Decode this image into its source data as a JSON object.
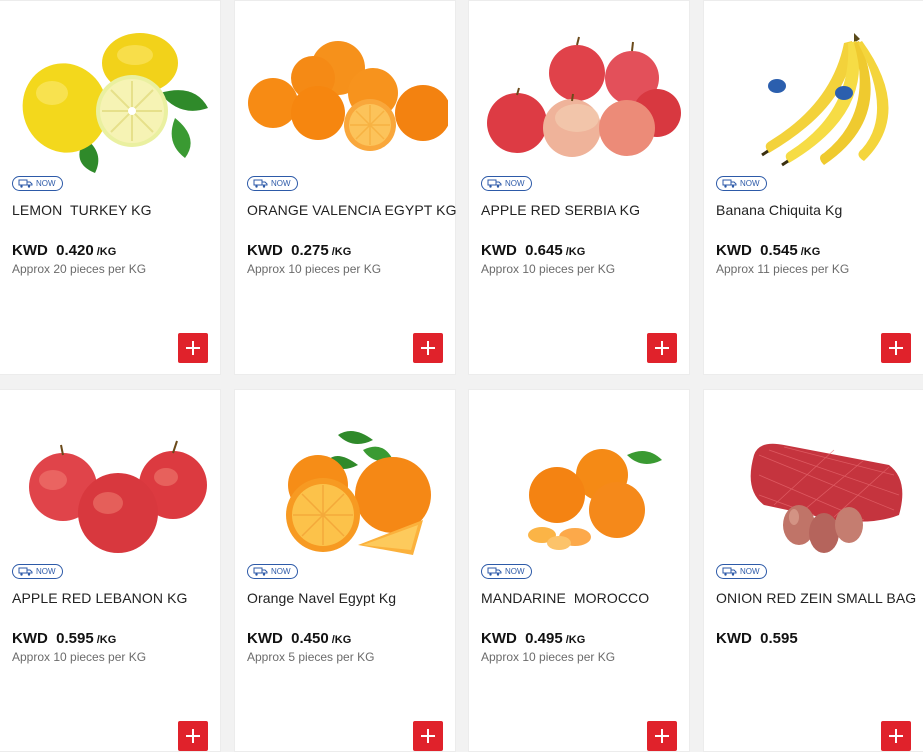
{
  "badge_label": "NOW",
  "accent_color": "#e0222b",
  "badge_color": "#2d5aa8",
  "currency": "KWD",
  "products": [
    {
      "name": "LEMON  TURKEY KG",
      "price": "0.420",
      "unit": "/KG",
      "approx": "Approx 20 pieces per KG",
      "image": "lemon-image"
    },
    {
      "name": "ORANGE VALENCIA EGYPT KG",
      "price": "0.275",
      "unit": "/KG",
      "approx": "Approx 10 pieces per KG",
      "image": "orange-valencia-image"
    },
    {
      "name": "APPLE RED SERBIA KG",
      "price": "0.645",
      "unit": "/KG",
      "approx": "Approx 10 pieces per KG",
      "image": "apple-red-serbia-image"
    },
    {
      "name": "Banana Chiquita Kg",
      "price": "0.545",
      "unit": "/KG",
      "approx": "Approx 11 pieces per KG",
      "image": "banana-image"
    },
    {
      "name": "APPLE RED LEBANON KG",
      "price": "0.595",
      "unit": "/KG",
      "approx": "Approx 10 pieces per KG",
      "image": "apple-red-lebanon-image"
    },
    {
      "name": "Orange Navel Egypt Kg",
      "price": "0.450",
      "unit": "/KG",
      "approx": "Approx 5 pieces per KG",
      "image": "orange-navel-image"
    },
    {
      "name": "MANDARINE  MOROCCO",
      "price": "0.495",
      "unit": "/KG",
      "approx": "Approx 10 pieces per KG",
      "image": "mandarine-image"
    },
    {
      "name": "ONION RED ZEIN SMALL BAG",
      "price": "0.595",
      "unit": "",
      "approx": "",
      "image": "onion-bag-image"
    }
  ]
}
